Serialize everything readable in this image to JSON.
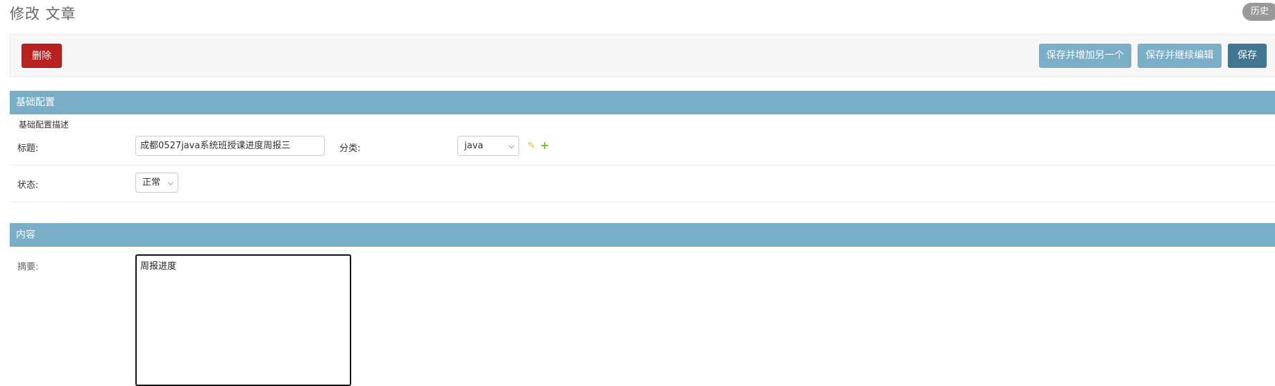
{
  "header": {
    "title": "修改 文章",
    "history_label": "历史"
  },
  "toolbar": {
    "delete_label": "删除",
    "save_add_label": "保存并增加另一个",
    "save_continue_label": "保存并继续编辑",
    "save_label": "保存"
  },
  "sections": [
    {
      "title": "基础配置",
      "description": "基础配置描述",
      "fields": {
        "title_label": "标题:",
        "title_value": "成都0527java系统班授课进度周报三",
        "category_label": "分类:",
        "category_value": "java",
        "status_label": "状态:",
        "status_value": "正常"
      }
    },
    {
      "title": "内容",
      "fields": {
        "summary_label": "摘要:",
        "summary_value": "周报进度"
      }
    }
  ],
  "icons": {
    "edit": "pencil-icon",
    "add": "plus-icon"
  },
  "colors": {
    "section_header": "#79aec8",
    "delete": "#ba2121",
    "save": "#417690",
    "secondary_save": "#79aec8"
  }
}
